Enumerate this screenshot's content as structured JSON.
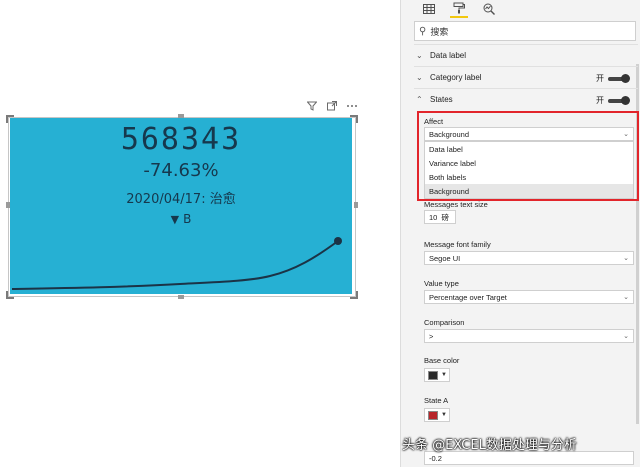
{
  "visual": {
    "value": "568343",
    "percent": "-74.63%",
    "date_label": "2020/04/17: 治愈",
    "indicator_arrow": "▼",
    "indicator_label": "B",
    "background_color": "#26b0d3",
    "text_color": "#16384d",
    "header_icons": [
      "filter-icon",
      "focus-mode-icon",
      "more-options-icon"
    ]
  },
  "pane": {
    "tabs": [
      "fields-icon",
      "format-paint-icon",
      "analytics-icon"
    ],
    "search_placeholder": "搜索",
    "sections": {
      "data_label": "Data label",
      "category_label": "Category label",
      "category_label_toggle": "开",
      "states": "States",
      "states_toggle": "开"
    },
    "affect": {
      "label": "Affect",
      "value": "Background",
      "options": [
        "Data label",
        "Variance label",
        "Both labels",
        "Background"
      ]
    },
    "messages_text_size": {
      "label": "Messages text size",
      "value": "10",
      "unit": "磅"
    },
    "message_font_family": {
      "label": "Message font family",
      "value": "Segoe UI"
    },
    "value_type": {
      "label": "Value type",
      "value": "Percentage over Target"
    },
    "comparison": {
      "label": "Comparison",
      "value": ">"
    },
    "base_color": {
      "label": "Base color",
      "color": "#2b2b2b"
    },
    "state_a": {
      "label": "State A",
      "color": "#b8262b"
    },
    "state_a_value": "-0.2"
  },
  "watermark": "头条 @EXCEL数据处理与分析",
  "colors": {
    "highlight": "#e2252b"
  }
}
